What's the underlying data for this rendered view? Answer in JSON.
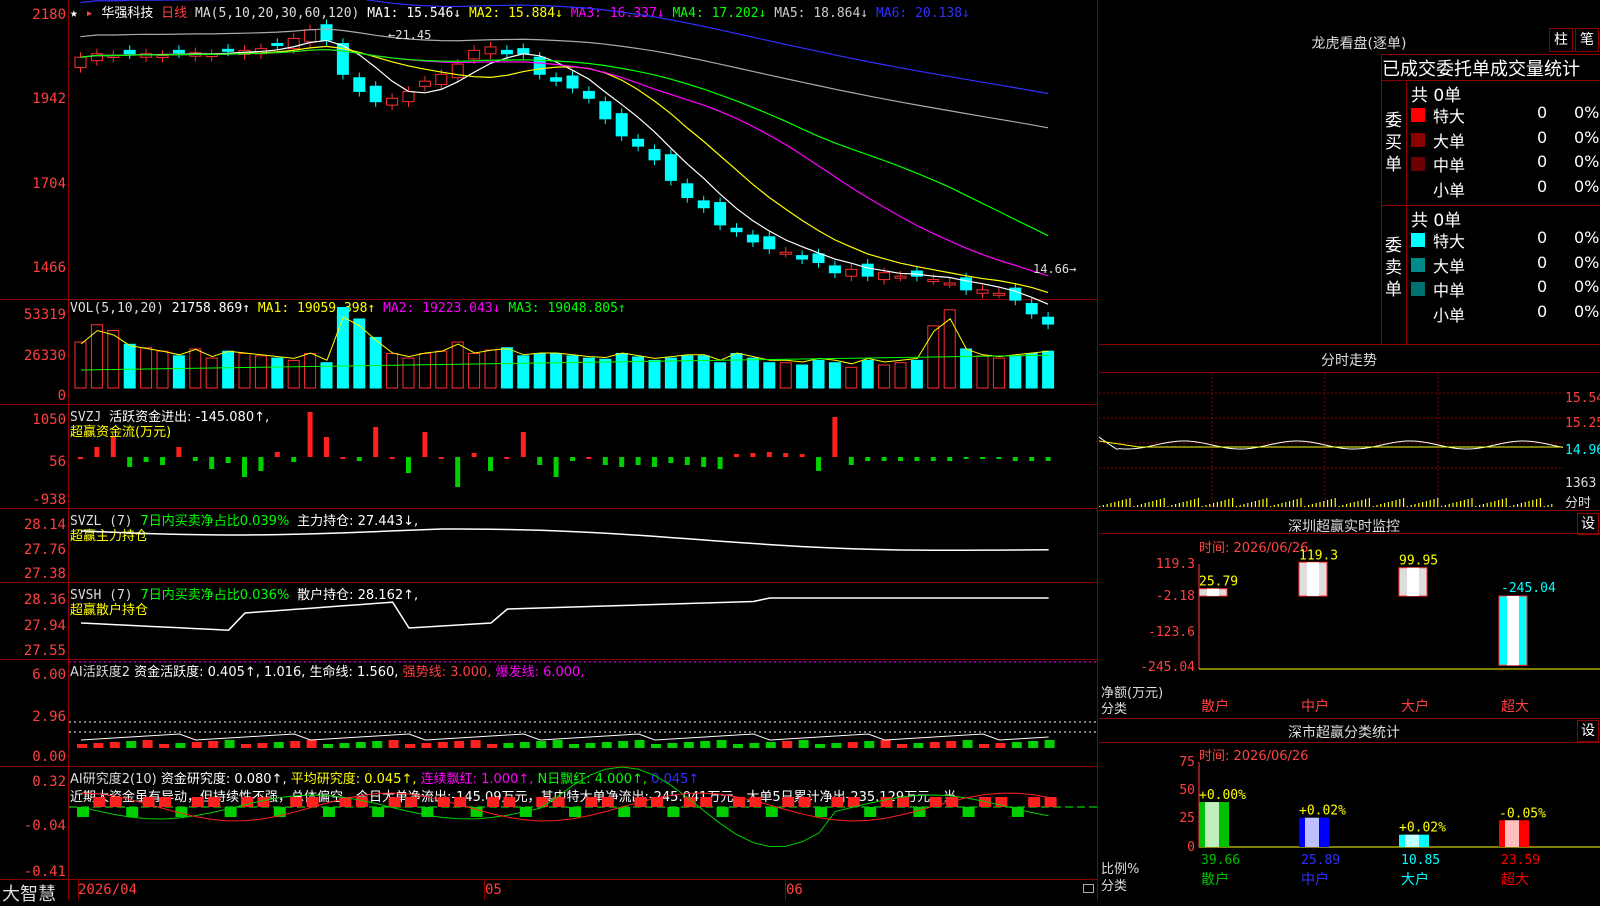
{
  "stock": {
    "name": "华强科技",
    "period": "日线"
  },
  "ma_header": {
    "label": "MA(5,10,20,30,60,120)",
    "ma1": "MA1: 15.546↓",
    "ma2": "MA2: 15.884↓",
    "ma3": "MA3: 16.337↓",
    "ma4": "MA4: 17.202↓",
    "ma5": "MA5: 18.864↓",
    "ma6": "MA6: 20.138↓"
  },
  "price_axis": [
    "2180",
    "1942",
    "1704",
    "1466"
  ],
  "price_high_label": "21.45",
  "price_low_label": "14.66",
  "vol_header": {
    "label": "VOL(5,10,20)",
    "value": "21758.869↑",
    "ma1": "MA1: 19059.398↑",
    "ma2": "MA2: 19223.043↓",
    "ma3": "MA3: 19048.805↑"
  },
  "vol_axis": [
    "53319",
    "26330",
    "0"
  ],
  "svzj_header": {
    "label": "SVZJ",
    "title": "活跃资金进出: -145.080↑,",
    "sub": "超赢资金流(万元)"
  },
  "svzj_axis": [
    "1050",
    "56",
    "-938"
  ],
  "svzl_header": {
    "label": "SVZL (7)",
    "pct": "7日内买卖净占比0.039%",
    "hold": "主力持仓: 27.443↓,",
    "sub": "超赢主力持仓"
  },
  "svzl_axis": [
    "28.14",
    "27.76",
    "27.38"
  ],
  "svsh_header": {
    "label": "SVSH (7)",
    "pct": "7日内买卖净占比0.036%",
    "hold": "散户持仓: 28.162↑,",
    "sub": "超赢散户持仓"
  },
  "svsh_axis": [
    "28.36",
    "27.94",
    "27.55"
  ],
  "ai_header": {
    "label": "AI活跃度2",
    "a": "资金活跃度: 0.405↑,",
    "b": "1.016,",
    "c": "生命线: 1.560,",
    "d": "强势线: 3.000,",
    "e": "爆发线: 6.000,"
  },
  "ai_axis": [
    "6.00",
    "2.96",
    "0.00"
  ],
  "ai2_header": {
    "label": "AI研究度2(10)",
    "a": "资金研究度: 0.080↑,",
    "b": "平均研究度: 0.045↑,",
    "c": "连续飘红: 1.000↑,",
    "d": "N日飘红: 4.000↑,",
    "e": "0.045↑"
  },
  "ai2_text": "近期大资金虽有异动，但持续性不强，总体偏空，今日大单净流出:-145.09万元，其中特大单净流出:-245.041万元，大单5日累计净出-235.129万元，当",
  "ai2_axis": [
    "0.32",
    "-0.04",
    "-0.41"
  ],
  "date_axis": [
    "2026/04",
    "05",
    "06"
  ],
  "brand": "大智慧",
  "right": {
    "lhb_title": "龙虎看盘(逐单)",
    "btn_zhu": "柱",
    "btn_bi": "笔",
    "stat_title": "已成交委托单成交量统计",
    "buy_label": "委买单",
    "sell_label": "委卖单",
    "buy_total": "共 0单",
    "sell_total": "共 0单",
    "buy_rows": [
      {
        "name": "特大",
        "n": "0",
        "p": "0%",
        "c": "#ff0000"
      },
      {
        "name": "大单",
        "n": "0",
        "p": "0%",
        "c": "#8b0000"
      },
      {
        "name": "中单",
        "n": "0",
        "p": "0%",
        "c": "#6b0000"
      },
      {
        "name": "小单",
        "n": "0",
        "p": "0%",
        "c": ""
      }
    ],
    "sell_rows": [
      {
        "name": "特大",
        "n": "0",
        "p": "0%",
        "c": "#00ffff"
      },
      {
        "name": "大单",
        "n": "0",
        "p": "0%",
        "c": "#008b8b"
      },
      {
        "name": "中单",
        "n": "0",
        "p": "0%",
        "c": "#007070"
      },
      {
        "name": "小单",
        "n": "0",
        "p": "0%",
        "c": ""
      }
    ],
    "fs_title": "分时走势",
    "fs_axis": [
      "15.54",
      "15.25",
      "14.96",
      "1363",
      "分时"
    ],
    "sz_title": "深圳超赢实时监控",
    "sz_set": "设",
    "sz_time": "时间: 2026/06/26",
    "sz_axis": [
      "119.3",
      "-2.18",
      "-123.6",
      "-245.04"
    ],
    "sz_ylabel": "净额(万元)",
    "sz_xlabel": "分类",
    "sz_bars": [
      {
        "cat": "散户",
        "val": "25.79",
        "v": 25.79
      },
      {
        "cat": "中户",
        "val": "119.3",
        "v": 119.3
      },
      {
        "cat": "大户",
        "val": "99.95",
        "v": 99.95
      },
      {
        "cat": "超大",
        "val": "-245.04",
        "v": -245.04
      }
    ],
    "cls_title": "深市超赢分类统计",
    "cls_set": "设",
    "cls_time": "时间: 2026/06/26",
    "cls_axis": [
      "75",
      "50",
      "25",
      "0"
    ],
    "cls_ylabel": "比例%",
    "cls_xlabel": "分类",
    "cls_bars": [
      {
        "cat": "散户",
        "val": "39.66",
        "chg": "+0.00%",
        "v": 39.66,
        "color": "#00c000"
      },
      {
        "cat": "中户",
        "val": "25.89",
        "chg": "+0.02%",
        "v": 25.89,
        "color": "#0000ff"
      },
      {
        "cat": "大户",
        "val": "10.85",
        "chg": "+0.02%",
        "v": 10.85,
        "color": "#00ffff"
      },
      {
        "cat": "超大",
        "val": "23.59",
        "chg": "-0.05%",
        "v": 23.59,
        "color": "#ff0000"
      }
    ]
  }
}
